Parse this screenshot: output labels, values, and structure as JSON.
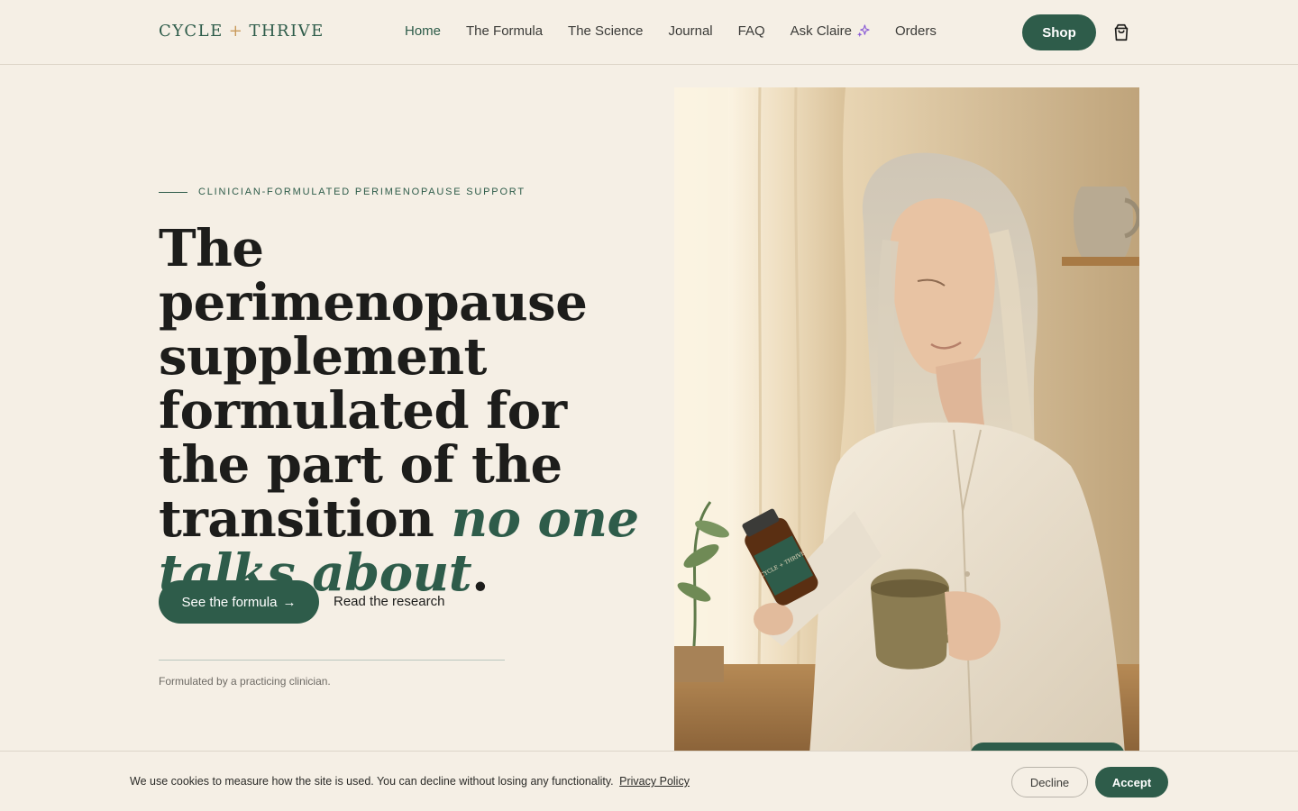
{
  "header": {
    "logo_left": "CYCLE",
    "logo_plus": "+",
    "logo_right": "THRIVE",
    "nav": [
      {
        "label": "Home"
      },
      {
        "label": "The Formula"
      },
      {
        "label": "The Science"
      },
      {
        "label": "Journal"
      },
      {
        "label": "FAQ"
      },
      {
        "label": "Ask Claire"
      },
      {
        "label": "Orders"
      }
    ],
    "shop_label": "Shop"
  },
  "hero": {
    "eyebrow": "CLINICIAN-FORMULATED PERIMENOPAUSE SUPPORT",
    "headline_plain": "The perimenopause supplement formulated for the part of the transition",
    "headline_italic": "no one talks about",
    "headline_end": ".",
    "cta_primary": "See the formula",
    "cta_arrow": "→",
    "cta_secondary": "Read the research",
    "footnote": "Formulated by a practicing clinician.",
    "bottle_label": "CYCLE + THRIVE"
  },
  "cookie": {
    "text": "We use cookies to measure how the site is used. You can decline without losing any functionality.",
    "link": "Privacy Policy",
    "decline": "Decline",
    "accept": "Accept"
  },
  "colors": {
    "brand": "#2e5c4a",
    "background": "#f5efe5",
    "accent": "#c99a5b",
    "sparkle": "#8a5bd6"
  }
}
